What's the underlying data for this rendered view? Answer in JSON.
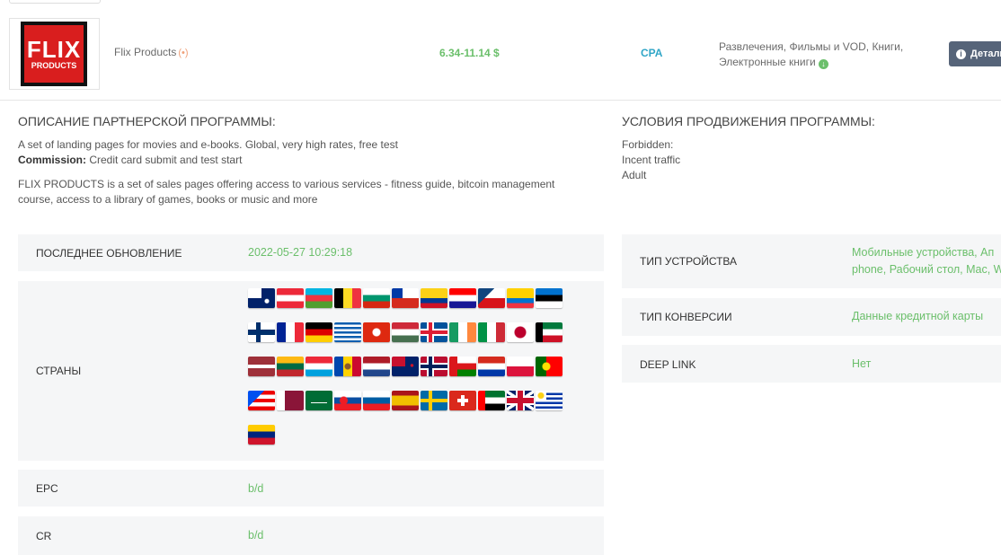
{
  "product": {
    "logo_title": "FLIX",
    "logo_subtitle": "PRODUCTS",
    "name": "Flix Products",
    "payout": "6.34-11.14 $",
    "model": "CPA",
    "categories_line1": "Развлечения, Фильмы и VOD, Книги,",
    "categories_line2": "Электронные книги",
    "details_label": "Детали"
  },
  "description": {
    "heading": "ОПИСАНИЕ ПАРТНЕРСКОЙ ПРОГРАММЫ:",
    "line1": "A set of landing pages for movies and e-books. Global, very high rates, free test",
    "commission_label": "Commission:",
    "commission_value": " Credit card submit and test start",
    "line3": "FLIX PRODUCTS is a set of sales pages offering access to various services - fitness guide, bitcoin management course, access to a library of games, books or music and more"
  },
  "conditions": {
    "heading": "УСЛОВИЯ ПРОДВИЖЕНИЯ ПРОГРАММЫ:",
    "lines": [
      "Forbidden:",
      "Incent traffic",
      "Adult"
    ]
  },
  "stats": {
    "last_update_label": "ПОСЛЕДНЕЕ ОБНОВЛЕНИЕ",
    "last_update_value": "2022-05-27 10:29:18",
    "countries_label": "СТРАНЫ",
    "epc_label": "EPC",
    "epc_value": "b/d",
    "cr_label": "CR",
    "cr_value": "b/d"
  },
  "right_stats": {
    "device_label": "ТИП УСТРОЙСТВА",
    "device_value_line1": "Мобильные устройства, Ап",
    "device_value_line2": "phone, Рабочий стол, Mac, W",
    "conversion_label": "ТИП КОНВЕРСИИ",
    "conversion_value": "Данные кредитной карты",
    "deeplink_label": "DEEP LINK",
    "deeplink_value": "Нет"
  },
  "flags": [
    "au",
    "at",
    "az",
    "be",
    "bg",
    "cl",
    "co",
    "hr",
    "cz",
    "ec",
    "ee",
    "fi",
    "fr",
    "de",
    "gr",
    "hk",
    "hu",
    "is",
    "ie",
    "it",
    "jp",
    "kw",
    "lv",
    "lt",
    "lu",
    "md",
    "nl",
    "nz",
    "no",
    "om",
    "py",
    "pl",
    "pt",
    "pr",
    "qa",
    "sa",
    "sk",
    "si",
    "es",
    "se",
    "ch",
    "ae",
    "gb",
    "uy",
    "ve"
  ],
  "colors": {
    "accent_green": "#6bbf6b",
    "model_blue": "#30a6c7",
    "button_bg": "#566479",
    "panel_bg": "#f5f6f7"
  }
}
